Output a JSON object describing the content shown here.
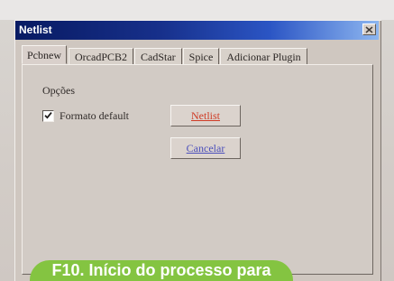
{
  "window": {
    "title": "Netlist"
  },
  "tabs": [
    {
      "label": "Pcbnew",
      "active": true
    },
    {
      "label": "OrcadPCB2",
      "active": false
    },
    {
      "label": "CadStar",
      "active": false
    },
    {
      "label": "Spice",
      "active": false
    },
    {
      "label": "Adicionar Plugin",
      "active": false
    }
  ],
  "options": {
    "label": "Opções",
    "checkbox": {
      "label": "Formato default",
      "checked": true
    }
  },
  "buttons": {
    "netlist": "Netlist",
    "cancel": "Cancelar"
  },
  "caption": {
    "text": "F10. Início do processo para"
  },
  "colors": {
    "title_start": "#081a62",
    "title_end": "#8db6f0",
    "netlist_text": "#cf3b25",
    "cancel_text": "#4b4fbb",
    "caption_bg": "#84c441"
  },
  "icons": {
    "close": "close-icon",
    "checkbox": "checkbox-check-icon"
  }
}
